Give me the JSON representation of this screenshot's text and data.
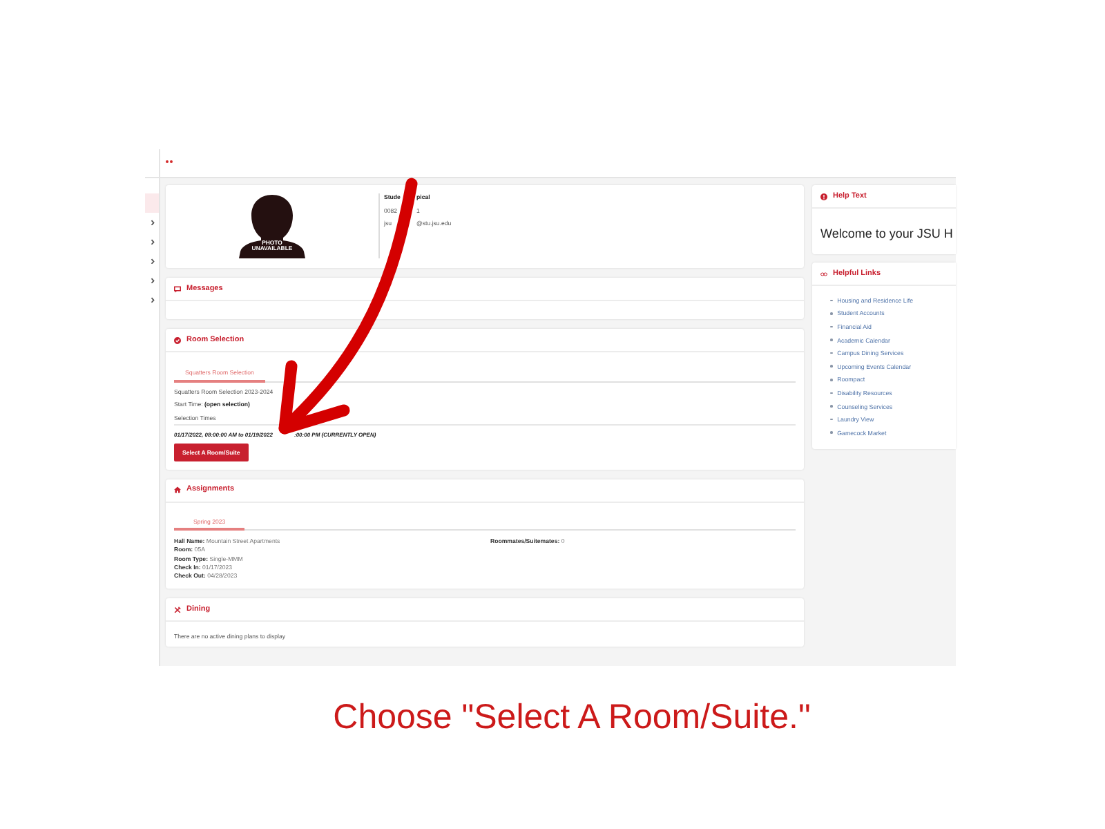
{
  "sidebar": {
    "items": [
      {
        "selected": true,
        "expandable": false
      },
      {
        "selected": false,
        "expandable": true
      },
      {
        "selected": false,
        "expandable": true
      },
      {
        "selected": false,
        "expandable": true
      },
      {
        "selected": false,
        "expandable": true
      },
      {
        "selected": false,
        "expandable": true
      }
    ]
  },
  "profile": {
    "photo_label": "PHOTO UNAVAILABLE",
    "name_parts": [
      "Stude",
      "pical"
    ],
    "id_parts": [
      "0082",
      "1"
    ],
    "email_parts": [
      "jsu",
      "@stu.jsu.edu"
    ]
  },
  "messages": {
    "title": "Messages"
  },
  "room_selection": {
    "title": "Room Selection",
    "tabs": [
      {
        "label": "Squatters Room Selection",
        "selected": true
      }
    ],
    "lines": [
      "Squatters Room Selection 2023-2024",
      "Start Time: **(open selection)**",
      "Selection Times"
    ],
    "time_parts": [
      "01/17/2022, 08:00:00 AM to 01/19/2022",
      ":00:00 PM (CURRENTLY OPEN)"
    ],
    "button": "Select A Room/Suite"
  },
  "assignments": {
    "title": "Assignments",
    "tabs": [
      {
        "label": "Spring 2023",
        "selected": true
      }
    ],
    "columns": [
      [
        "**Hall Name:** Mountain Street Apartments",
        "**Room:** 05A",
        "**Room Type:** Single-MMM",
        "**Check In:** 01/17/2023",
        "**Check Out:** 04/28/2023"
      ],
      [
        "**Roommates/Suitemates:** 0"
      ]
    ]
  },
  "dining": {
    "title": "Dining",
    "message": "There are no active dining plans to display"
  },
  "help_text": {
    "title": "Help Text",
    "body": "Welcome to your JSU H"
  },
  "helpful_links": {
    "title": "Helpful Links",
    "links": [
      "Housing and Residence Life",
      "Student Accounts",
      "Financial Aid",
      "Academic Calendar",
      "Campus Dining Services",
      "Upcoming Events Calendar",
      "Roompact",
      "Disability Resources",
      "Counseling Services",
      "Laundry View",
      "Gamecock Market"
    ]
  },
  "caption": "Choose \"Select A Room/Suite.\""
}
